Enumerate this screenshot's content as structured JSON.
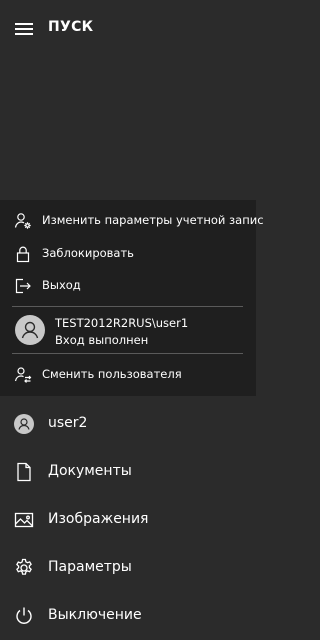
{
  "header": {
    "title": "ПУСК"
  },
  "account_menu": {
    "items": [
      {
        "label": "Изменить параметры учетной запис",
        "icon": "user-settings-icon"
      },
      {
        "label": "Заблокировать",
        "icon": "lock-icon"
      },
      {
        "label": "Выход",
        "icon": "sign-out-icon"
      }
    ],
    "current_user": {
      "name": "TEST2012R2RUS\\user1",
      "status": "Вход выполнен",
      "icon": "user-avatar-icon"
    },
    "switch_user": {
      "label": "Сменить пользователя",
      "icon": "switch-user-icon"
    }
  },
  "menu": {
    "items": [
      {
        "label": "user2",
        "icon": "user-avatar-icon"
      },
      {
        "label": "Документы",
        "icon": "document-icon"
      },
      {
        "label": "Изображения",
        "icon": "image-icon"
      },
      {
        "label": "Параметры",
        "icon": "gear-icon"
      },
      {
        "label": "Выключение",
        "icon": "power-icon"
      }
    ]
  },
  "colors": {
    "background": "#2b2b2b",
    "popup_background": "#1f1f1f",
    "text": "#ffffff",
    "divider": "#5a5a5a"
  }
}
